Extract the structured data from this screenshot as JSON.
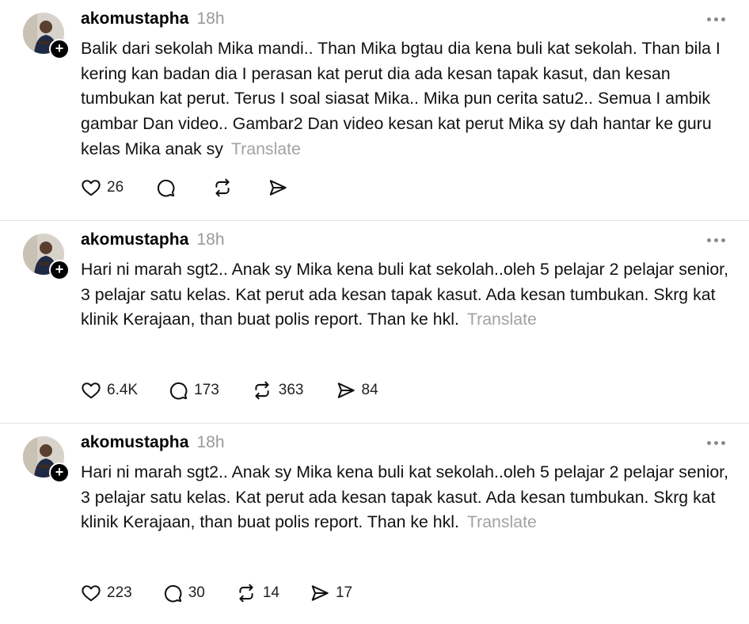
{
  "posts": [
    {
      "username": "akomustapha",
      "time": "18h",
      "text": "Balik dari sekolah Mika mandi.. Than Mika bgtau dia kena buli kat sekolah. Than bila I kering kan badan dia I perasan kat perut dia ada kesan tapak kasut, dan kesan tumbukan kat perut. Terus I soal siasat Mika.. Mika pun cerita satu2.. Semua I ambik gambar Dan video.. Gambar2 Dan video kesan kat perut Mika sy dah hantar ke guru kelas Mika anak sy",
      "translate": "Translate",
      "likes": "26",
      "replies": "",
      "reposts": "",
      "shares": ""
    },
    {
      "username": "akomustapha",
      "time": "18h",
      "text": "Hari ni marah sgt2.. Anak sy Mika kena buli kat sekolah..oleh 5 pelajar 2 pelajar senior, 3 pelajar satu kelas. Kat perut ada kesan tapak kasut. Ada kesan tumbukan. Skrg kat klinik Kerajaan, than buat polis report. Than ke hkl.",
      "translate": "Translate",
      "likes": "6.4K",
      "replies": "173",
      "reposts": "363",
      "shares": "84"
    },
    {
      "username": "akomustapha",
      "time": "18h",
      "text": "Hari ni marah sgt2.. Anak sy Mika kena buli kat sekolah..oleh 5 pelajar 2 pelajar senior, 3 pelajar satu kelas. Kat perut ada kesan tapak kasut. Ada kesan tumbukan. Skrg kat klinik Kerajaan, than buat polis report. Than ke hkl.",
      "translate": "Translate",
      "likes": "223",
      "replies": "30",
      "reposts": "14",
      "shares": "17"
    }
  ],
  "icons": {
    "like": "heart-icon",
    "reply": "comment-icon",
    "repost": "repost-icon",
    "share": "send-icon",
    "more": "more-dots-icon",
    "follow": "plus-icon"
  },
  "follow_badge": "+"
}
